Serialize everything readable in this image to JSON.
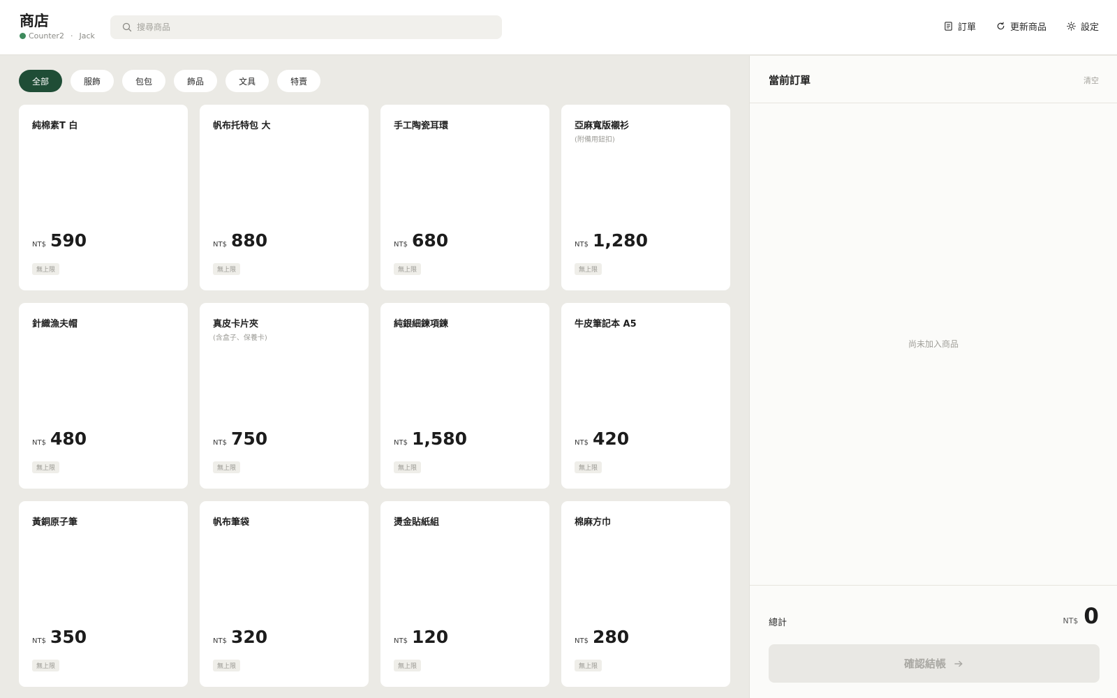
{
  "header": {
    "title": "商店",
    "counter": "Counter2",
    "separator": "·",
    "user": "Jack",
    "search_placeholder": "搜尋商品",
    "actions": [
      {
        "label": "訂單",
        "icon": "receipt-icon"
      },
      {
        "label": "更新商品",
        "icon": "refresh-icon"
      },
      {
        "label": "設定",
        "icon": "gear-icon"
      }
    ]
  },
  "categories": [
    "全部",
    "服飾",
    "包包",
    "飾品",
    "文具",
    "特賣"
  ],
  "active_category": "全部",
  "currency": "NT$",
  "products": [
    {
      "name": "純棉素T 白",
      "note": "",
      "price": "590",
      "stock": "無上限"
    },
    {
      "name": "帆布托特包 大",
      "note": "",
      "price": "880",
      "stock": "無上限"
    },
    {
      "name": "手工陶瓷耳環",
      "note": "",
      "price": "680",
      "stock": "無上限"
    },
    {
      "name": "亞麻寬版襯衫",
      "note": "(附備用鈕扣)",
      "price": "1,280",
      "stock": "無上限"
    },
    {
      "name": "針織漁夫帽",
      "note": "",
      "price": "480",
      "stock": "無上限"
    },
    {
      "name": "真皮卡片夾",
      "note": "(含盒子、保養卡)",
      "price": "750",
      "stock": "無上限"
    },
    {
      "name": "純銀細鍊項鍊",
      "note": "",
      "price": "1,580",
      "stock": "無上限"
    },
    {
      "name": "牛皮筆記本 A5",
      "note": "",
      "price": "420",
      "stock": "無上限"
    },
    {
      "name": "黃銅原子筆",
      "note": "",
      "price": "350",
      "stock": "無上限"
    },
    {
      "name": "帆布筆袋",
      "note": "",
      "price": "320",
      "stock": "無上限"
    },
    {
      "name": "燙金貼紙組",
      "note": "",
      "price": "120",
      "stock": "無上限"
    },
    {
      "name": "棉麻方巾",
      "note": "",
      "price": "280",
      "stock": "無上限"
    }
  ],
  "order": {
    "title": "當前訂單",
    "clear_label": "清空",
    "empty_message": "尚未加入商品",
    "total_label": "總計",
    "total_currency": "NT$",
    "total_value": "0",
    "checkout_label": "確認結帳"
  },
  "colors": {
    "accent": "#1f4d36",
    "status": "#3e8a5c",
    "background": "#ebeae5"
  }
}
